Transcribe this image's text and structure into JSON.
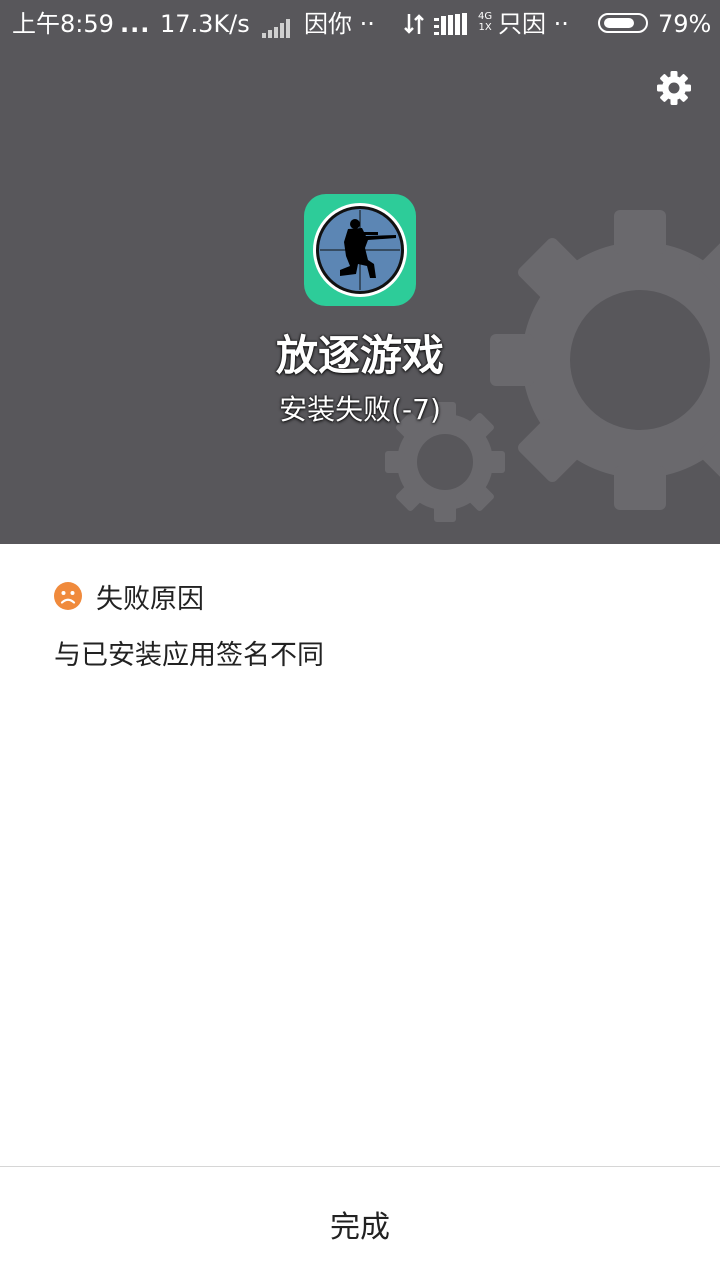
{
  "status_bar": {
    "time": "上午8:59",
    "dots": "...",
    "speed": "17.3K/s",
    "carrier1": "因你 ··",
    "network_top": "4G",
    "network_bottom": "1X",
    "carrier2": "只因 ··",
    "battery_percent": "79%",
    "battery_level": 0.79
  },
  "app": {
    "name": "放逐游戏",
    "status": "安装失败(-7)",
    "icon_bg_color": "#2dcc99"
  },
  "failure": {
    "title": "失败原因",
    "reason": "与已安装应用签名不同",
    "icon_color": "#f08a3c"
  },
  "actions": {
    "done_label": "完成"
  },
  "icons": {
    "settings": "gear-icon",
    "sad": "sad-face-icon",
    "app": "sniper-crosshair-icon"
  }
}
